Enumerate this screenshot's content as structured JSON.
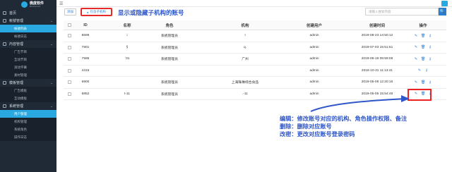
{
  "app": {
    "logo_text": "微度软件",
    "logo_sub": "Blueworld"
  },
  "sidebar": {
    "items": [
      {
        "type": "group",
        "label": "首页",
        "chev": ""
      },
      {
        "type": "group",
        "label": "帐號管理",
        "chev": "⌄"
      },
      {
        "type": "sub",
        "label": "帐號列表",
        "active": true
      },
      {
        "type": "sub",
        "label": "帐號日志",
        "active": false
      },
      {
        "type": "group",
        "label": "內容管理",
        "chev": "⌄"
      },
      {
        "type": "sub",
        "label": "广告节目",
        "active": false
      },
      {
        "type": "sub",
        "label": "互动节目",
        "active": false
      },
      {
        "type": "sub",
        "label": "滚动字幕",
        "active": false
      },
      {
        "type": "sub",
        "label": "素材管理",
        "active": false
      },
      {
        "type": "group",
        "label": "模板管理",
        "chev": "⌄"
      },
      {
        "type": "sub",
        "label": "广告模板",
        "active": false
      },
      {
        "type": "sub",
        "label": "互动模板",
        "active": false
      },
      {
        "type": "group",
        "label": "系統管理",
        "chev": "⌄"
      },
      {
        "type": "sub",
        "label": "用户管理",
        "active": true
      },
      {
        "type": "sub",
        "label": "机构管理",
        "active": false
      },
      {
        "type": "sub",
        "label": "系統角色",
        "active": false
      },
      {
        "type": "sub",
        "label": "操作日志",
        "active": false
      }
    ]
  },
  "toolbar": {
    "add_label": "添加",
    "toggle_label": "包含子机构",
    "hint": "显示或隐藏子机构的账号",
    "search_placeholder": "请输入搜索内容",
    "search_icon": "🔍"
  },
  "table": {
    "headers": {
      "id": "ID",
      "name": "名称",
      "role": "角色",
      "org": "机构",
      "creator": "创建用户",
      "time": "创建时间",
      "ops": "操作"
    },
    "rows": [
      {
        "id": "8599",
        "name": "i",
        "role": "系統管理员",
        "org": "I",
        "creator": "admin",
        "time": "2019-08-23 14:50:12",
        "ops": [
          "✎",
          "🗑",
          "⚷"
        ]
      },
      {
        "id": "7801",
        "name": "§",
        "role": "系統管理员",
        "org": "q.",
        "creator": "admin",
        "time": "2019-07-03 15:51:51",
        "ops": [
          "✎",
          "🗑",
          "⚷"
        ]
      },
      {
        "id": "7585",
        "name": "`01",
        "role": "系統管理员",
        "org": "广州",
        "creator": "admin",
        "time": "2019-06-19 09:59:06",
        "ops": [
          "✎",
          "🗑",
          "⚷"
        ]
      },
      {
        "id": "4315",
        "name": "",
        "role": "",
        "org": "",
        "creator": "admin",
        "time": "2018-10-31 11:13:41",
        "ops": [
          "✎",
          "⚷"
        ]
      },
      {
        "id": "6900",
        "name": "",
        "role": "系統管理员",
        "org": "上海珠琳综合食品",
        "creator": "admin",
        "time": "2019-05-08 12:20:16",
        "ops": [
          "✎",
          "🗑",
          "⚷"
        ]
      },
      {
        "id": "6852",
        "name": "t-11",
        "role": "系統管理员",
        "org": ".-11",
        "creator": "admin",
        "time": "2019-05-05 15:54:48",
        "ops": [
          "✎",
          "🗑",
          "⚷"
        ]
      }
    ]
  },
  "annotation": {
    "line1": "编辑：修改账号对应的机构、角色操作权限、备注",
    "line2": "删除：删除对应账号",
    "line3": "改密：更改对应账号登录密码"
  },
  "colors": {
    "accent": "#2aa8e0",
    "sidebar_bg": "#1f2a36",
    "annot": "#2f57c9",
    "highlight": "#e22222"
  }
}
